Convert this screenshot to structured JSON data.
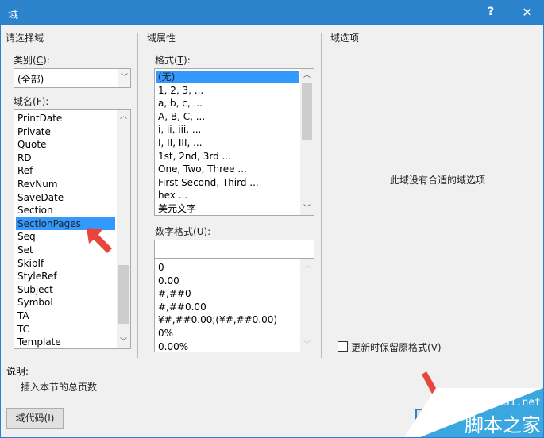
{
  "window": {
    "title": "域",
    "help_label": "?",
    "close_label": "✕"
  },
  "select_field": {
    "group_title": "请选择域",
    "category_label": "类别(",
    "category_key": "C",
    "category_label_end": "):",
    "category_value": "(全部)",
    "fieldname_label": "域名(",
    "fieldname_key": "F",
    "fieldname_label_end": "):",
    "field_names": [
      "PrintDate",
      "Private",
      "Quote",
      "RD",
      "Ref",
      "RevNum",
      "SaveDate",
      "Section",
      "SectionPages",
      "Seq",
      "Set",
      "SkipIf",
      "StyleRef",
      "Subject",
      "Symbol",
      "TA",
      "TC",
      "Template"
    ],
    "selected_field": "SectionPages"
  },
  "field_properties": {
    "group_title": "域属性",
    "format_label": "格式(",
    "format_key": "T",
    "format_label_end": "):",
    "formats": [
      "(无)",
      "1, 2, 3, ...",
      "a, b, c, ...",
      "A, B, C, ...",
      "i, ii, iii, ...",
      "I, II, III, ...",
      "1st, 2nd, 3rd ...",
      "One, Two, Three ...",
      "First Second, Third ...",
      "hex ...",
      "美元文字"
    ],
    "selected_format": "(无)",
    "number_format_label": "数字格式(",
    "number_format_key": "U",
    "number_format_label_end": "):",
    "number_format_value": "",
    "number_formats": [
      "0",
      "0.00",
      "#,##0",
      "#,##0.00",
      "¥#,##0.00;(¥#,##0.00)",
      "0%",
      "0.00%"
    ]
  },
  "field_options": {
    "group_title": "域选项",
    "empty_message": "此域没有合适的域选项",
    "preserve_format_label": "更新时保留原格式(",
    "preserve_format_key": "V",
    "preserve_format_label_end": ")",
    "preserve_format_checked": false
  },
  "description": {
    "title": "说明:",
    "text": "插入本节的总页数"
  },
  "buttons": {
    "field_codes": "域代码(I)",
    "ok": "确定"
  },
  "watermark": {
    "site": "jb51.net",
    "name": "脚本之家"
  },
  "colors": {
    "titlebar": "#2b83cc",
    "selection": "#3399ff",
    "arrow": "#e8453c",
    "watermark": "#3aa7e0"
  }
}
